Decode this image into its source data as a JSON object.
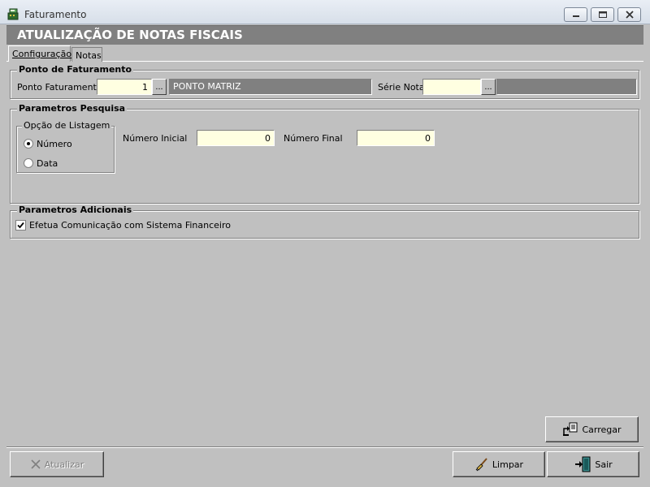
{
  "window": {
    "title": "Faturamento",
    "icons": {
      "app": "cash-register-icon",
      "minimize": "minimize-icon",
      "maximize": "maximize-icon",
      "close": "close-icon"
    }
  },
  "header": {
    "title": "ATUALIZAÇÃO DE NOTAS FISCAIS"
  },
  "tabs": [
    {
      "label": "Configuração",
      "active": true
    },
    {
      "label": "Notas",
      "active": false
    }
  ],
  "ponto_faturamento": {
    "group_title": "Ponto de Faturamento",
    "ponto_label": "Ponto Faturamento",
    "ponto_value": "1",
    "ponto_button": "...",
    "ponto_description": "PONTO MATRIZ",
    "serie_label": "Série Nota",
    "serie_value": "",
    "serie_button": "...",
    "serie_description": ""
  },
  "parametros_pesquisa": {
    "group_title": "Parametros Pesquisa",
    "opcao_title": "Opção de Listagem",
    "options": [
      {
        "label": "Número",
        "selected": true
      },
      {
        "label": "Data",
        "selected": false
      }
    ],
    "numero_inicial_label": "Número Inicial",
    "numero_inicial_value": "0",
    "numero_final_label": "Número Final",
    "numero_final_value": "0"
  },
  "parametros_adicionais": {
    "group_title": "Parametros Adicionais",
    "financeiro_label": "Efetua Comunicação com Sistema Financeiro",
    "financeiro_checked": true
  },
  "buttons": {
    "carregar": "Carregar",
    "atualizar": "Atualizar",
    "limpar": "Limpar",
    "sair": "Sair"
  },
  "colors": {
    "field_bg": "#ffffe1",
    "readonly_bg": "#808080",
    "header_bg": "#808080",
    "panel_bg": "#c0c0c0"
  }
}
